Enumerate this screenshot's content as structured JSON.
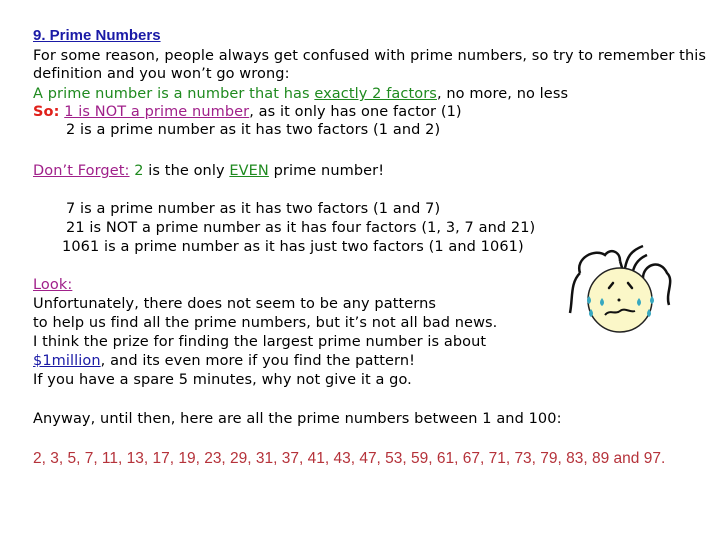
{
  "title": "9. Prime Numbers",
  "intro": {
    "line1": "For some reason, people always get confused with prime numbers, so try to remember this",
    "line2": "definition and you won’t go wrong:"
  },
  "definition": {
    "prefix": "A prime number is a number that has ",
    "emphasis": "exactly 2 factors",
    "suffix": ", no more, no less"
  },
  "so": {
    "label": "So:",
    "emphasis": "1 is NOT a prime number",
    "suffix": ", as it only has one factor (1)"
  },
  "example_two": "2 is a prime number as it has two factors (1 and 2)",
  "dont_forget": {
    "label": "Don’t Forget:",
    "two": "2",
    "middle": " is the only ",
    "even": "EVEN",
    "suffix": " prime number!"
  },
  "examples": [
    "7 is a prime number as it has two factors (1 and 7)",
    "21 is NOT a prime number as it has four factors (1, 3, 7 and 21)",
    "1061 is a prime number as it has just two factors (1 and 1061)"
  ],
  "look": {
    "label": "Look:",
    "lines": [
      "Unfortunately, there does not seem to be any patterns",
      "to help us find all the prime numbers, but it’s not all bad news.",
      "I think the prize for finding the largest prime number is about"
    ],
    "prize_link": "$1million",
    "prize_suffix": ", and its even more if you find the pattern!",
    "last_line": "If you have a spare 5 minutes, why not give it a go."
  },
  "anyway": "Anyway, until then, here are all the prime numbers between 1 and 100:",
  "primes_list": "2, 3, 5, 7, 11, 13, 17, 19, 23, 29, 31, 37, 41, 43, 47, 53, 59, 61, 67, 71, 73, 79, 83, 89 and 97.",
  "illustration": "crying-face"
}
